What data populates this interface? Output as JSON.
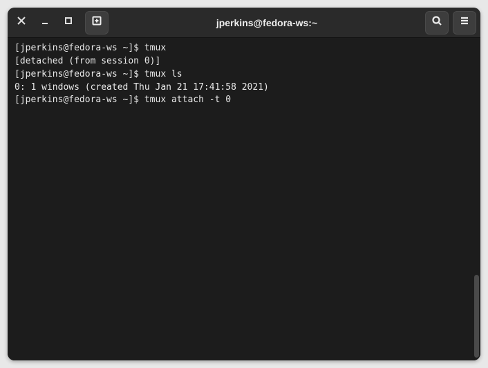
{
  "titlebar": {
    "title": "jperkins@fedora-ws:~"
  },
  "terminal": {
    "lines": [
      {
        "prompt": "[jperkins@fedora-ws ~]$ ",
        "command": "tmux"
      },
      {
        "output": "[detached (from session 0)]"
      },
      {
        "prompt": "[jperkins@fedora-ws ~]$ ",
        "command": "tmux ls"
      },
      {
        "output": "0: 1 windows (created Thu Jan 21 17:41:58 2021)"
      },
      {
        "prompt": "[jperkins@fedora-ws ~]$ ",
        "command": "tmux attach -t 0"
      }
    ]
  }
}
